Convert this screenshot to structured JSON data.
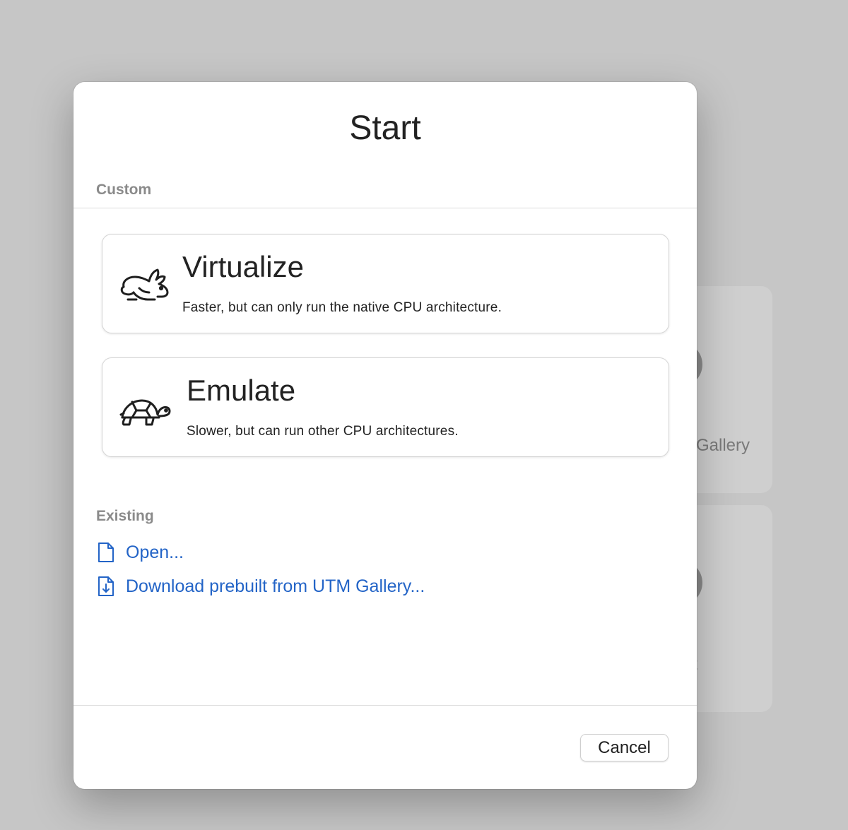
{
  "background": {
    "card_text_1": "Gallery",
    "card_text_2": "t"
  },
  "dialog": {
    "title": "Start",
    "custom_label": "Custom",
    "options": [
      {
        "icon": "hare-icon",
        "title": "Virtualize",
        "description": "Faster, but can only run the native CPU architecture."
      },
      {
        "icon": "tortoise-icon",
        "title": "Emulate",
        "description": "Slower, but can run other CPU architectures."
      }
    ],
    "existing_label": "Existing",
    "links": [
      {
        "icon": "document-icon",
        "label": "Open..."
      },
      {
        "icon": "document-download-icon",
        "label": "Download prebuilt from UTM Gallery..."
      }
    ],
    "cancel_label": "Cancel"
  },
  "colors": {
    "link": "#2364c7",
    "section_label": "#8a8a8a",
    "backdrop": "#c6c6c6"
  }
}
